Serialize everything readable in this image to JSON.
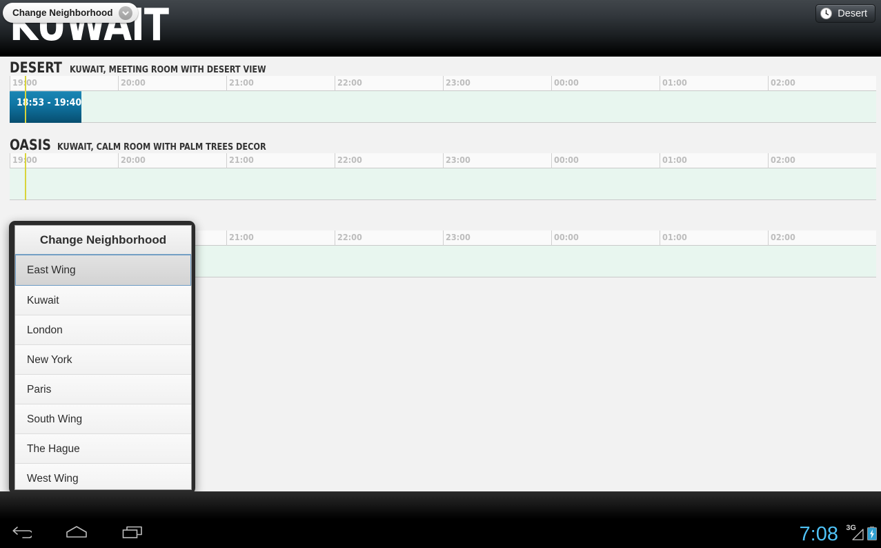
{
  "header": {
    "title": "KUWAIT"
  },
  "timeline": {
    "ticks": [
      "19:00",
      "20:00",
      "21:00",
      "22:00",
      "23:00",
      "00:00",
      "01:00",
      "02:00"
    ]
  },
  "rooms": [
    {
      "name": "DESERT",
      "desc": "KUWAIT, MEETING ROOM WITH DESERT VIEW",
      "booking": {
        "label": "18:53 - 19:40"
      }
    },
    {
      "name": "OASIS",
      "desc": "KUWAIT, CALM ROOM WITH PALM TREES DECOR",
      "booking": null
    },
    {
      "name": "",
      "desc": "",
      "booking": null
    }
  ],
  "dialog": {
    "title": "Change Neighborhood",
    "items": [
      {
        "label": "East Wing",
        "selected": true
      },
      {
        "label": "Kuwait",
        "selected": false
      },
      {
        "label": "London",
        "selected": false
      },
      {
        "label": "New York",
        "selected": false
      },
      {
        "label": "Paris",
        "selected": false
      },
      {
        "label": "South Wing",
        "selected": false
      },
      {
        "label": "The Hague",
        "selected": false
      },
      {
        "label": "West Wing",
        "selected": false
      }
    ]
  },
  "action_bar": {
    "change_neighborhood_label": "Change Neighborhood",
    "current_room_label": "Desert"
  },
  "system_bar": {
    "clock": "7:08",
    "network": "3G"
  },
  "colors": {
    "accent_blue": "#1178a6",
    "now_line": "#d8d43a",
    "free_slot": "#e8f6ef",
    "clock_blue": "#4fc3f7",
    "selected_border": "#6a9ac4"
  }
}
